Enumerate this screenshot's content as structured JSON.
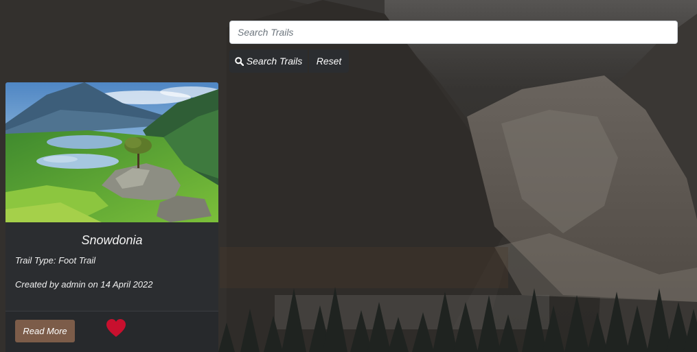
{
  "search": {
    "placeholder": "Search Trails",
    "value": "",
    "search_button_label": "Search Trails",
    "reset_button_label": "Reset"
  },
  "card": {
    "title": "Snowdonia",
    "trail_type_label": "Trail Type:",
    "trail_type": "Foot Trail",
    "created_prefix": "Created by",
    "author": "admin",
    "created_on": "on",
    "date": "14 April 2022",
    "read_more_label": "Read More",
    "favorite": true
  },
  "colors": {
    "card_bg": "#2b2d30",
    "read_more_bg": "#7c5c49",
    "heart": "#c8102e",
    "button_dark": "#2b2d30"
  },
  "icons": {
    "search_button": "search-icon",
    "favorite": "heart-icon"
  }
}
